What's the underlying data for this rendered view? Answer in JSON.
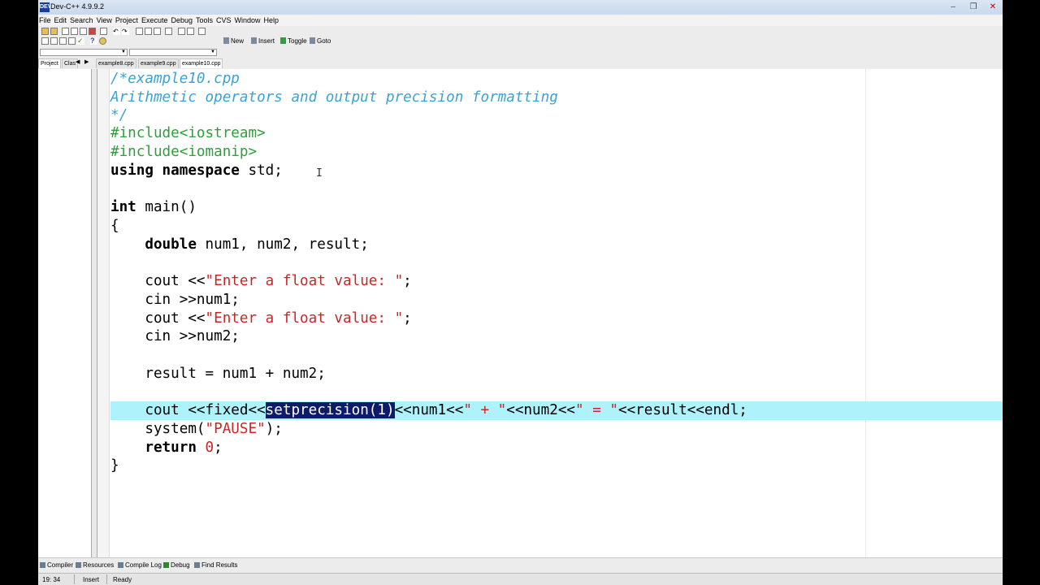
{
  "window": {
    "title": "Dev-C++ 4.9.9.2",
    "icon_text": "DEV"
  },
  "menu": [
    "File",
    "Edit",
    "Search",
    "View",
    "Project",
    "Execute",
    "Debug",
    "Tools",
    "CVS",
    "Window",
    "Help"
  ],
  "toolbar": {
    "new_label": "New",
    "insert_label": "Insert",
    "toggle_label": "Toggle",
    "goto_label": "Goto"
  },
  "panel_tabs": {
    "project": "Project",
    "classes": "Clas"
  },
  "file_tabs": [
    "example8.cpp",
    "example9.cpp",
    "example10.cpp"
  ],
  "active_file": "example10.cpp",
  "code": {
    "l1": "/*example10.cpp",
    "l2": "Arithmetic operators and output precision formatting",
    "l3": "*/",
    "l4": "#include<iostream>",
    "l5": "#include<iomanip>",
    "l6_kw": "using namespace",
    "l6_rest": " std;",
    "l8_kw": "int",
    "l8_rest": " main()",
    "l9": "{",
    "l10_indent": "    ",
    "l10_kw": "double",
    "l10_rest": " num1, num2, result;",
    "l12_a": "    cout <<",
    "l12_str": "\"Enter a float value: \"",
    "l12_end": ";",
    "l13": "    cin >>num1;",
    "l14_a": "    cout <<",
    "l14_str": "\"Enter a float value: \"",
    "l14_end": ";",
    "l15": "    cin >>num2;",
    "l17": "    result = num1 + num2;",
    "l19_a": "    cout <<fixed<<",
    "l19_sel": "setprecision(1)",
    "l19_b": "<<num1<<",
    "l19_s1": "\" + \"",
    "l19_c": "<<num2<<",
    "l19_s2": "\" = \"",
    "l19_d": "<<result<<endl;",
    "l20_a": "    system(",
    "l20_str": "\"PAUSE\"",
    "l20_end": ");",
    "l21_indent": "    ",
    "l21_kw": "return",
    "l21_sp": " ",
    "l21_num": "0",
    "l21_end": ";",
    "l22": "}"
  },
  "bottom_tabs": [
    "Compiler",
    "Resources",
    "Compile Log",
    "Debug",
    "Find Results"
  ],
  "status": {
    "position": "19: 34",
    "mode": "Insert",
    "state": "Ready"
  },
  "colors": {
    "comment": "#3ba3d4",
    "preprocessor": "#2e9f3a",
    "string": "#c62828",
    "highlight_line": "#aef2fc",
    "selection": "#0d1b69"
  }
}
